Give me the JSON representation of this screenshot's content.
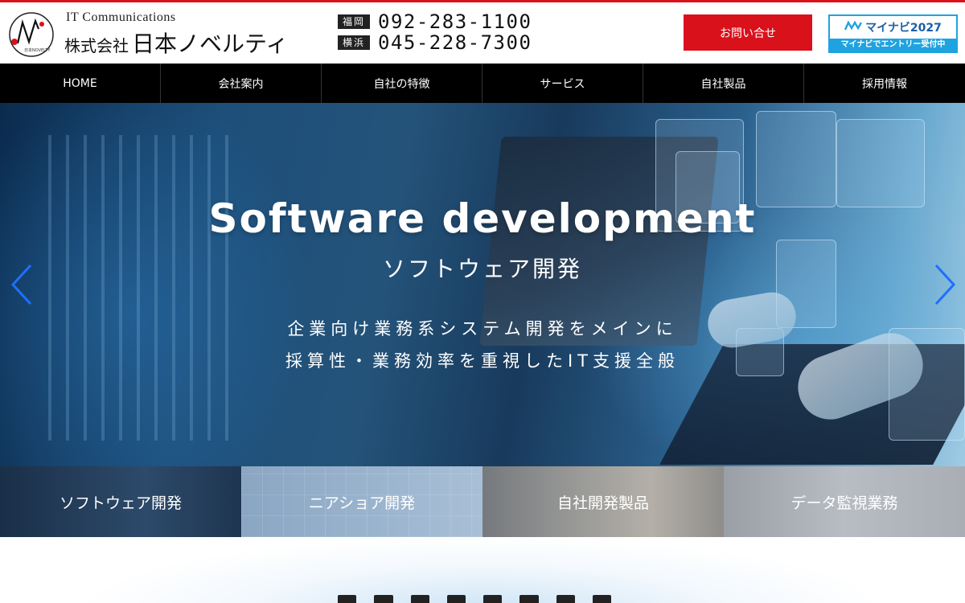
{
  "header": {
    "tagline": "IT Communications",
    "company_prefix": "株式会社",
    "company_name": "日本ノベルティ",
    "logo_text": "日本NOVELTY",
    "phones": [
      {
        "city": "福岡",
        "number": "092-283-1100"
      },
      {
        "city": "横浜",
        "number": "045-228-7300"
      }
    ],
    "contact_label": "お問い合せ",
    "mynavi": {
      "brand": "マイナビ2027",
      "sub": "マイナビでエントリー受付中"
    }
  },
  "nav": {
    "items": [
      "HOME",
      "会社案内",
      "自社の特徴",
      "サービス",
      "自社製品",
      "採用情報"
    ]
  },
  "hero": {
    "title": "Software development",
    "subtitle": "ソフトウェア開発",
    "description": [
      "企業向け業務系システム開発をメインに",
      "採算性・業務効率を重視したIT支援全般"
    ]
  },
  "tiles": [
    "ソフトウェア開発",
    "ニアショア開発",
    "自社開発製品",
    "データ監視業務"
  ],
  "colors": {
    "accent": "#d9111b",
    "nav_bg": "#000000",
    "arrow": "#1e6fff",
    "mynavi": "#1fa3e0"
  },
  "icons": {
    "prev": "chevron-left-icon",
    "next": "chevron-right-icon"
  }
}
